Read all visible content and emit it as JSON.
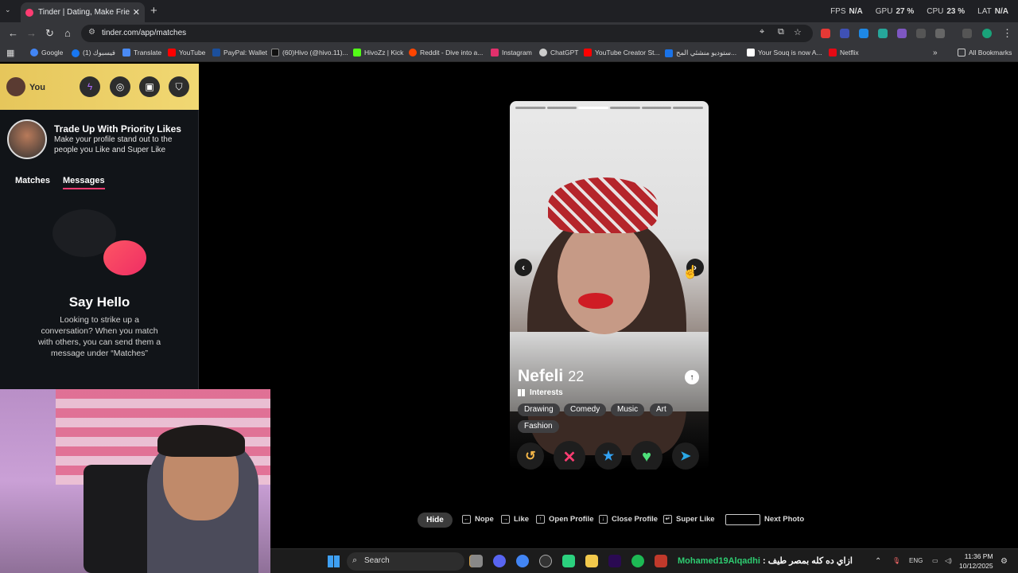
{
  "browser": {
    "tab_title": "Tinder | Dating, Make Friends &",
    "url": "tinder.com/app/matches",
    "perf": [
      {
        "label": "FPS",
        "value": "N/A"
      },
      {
        "label": "GPU",
        "value": "27 %"
      },
      {
        "label": "CPU",
        "value": "23 %"
      },
      {
        "label": "LAT",
        "value": "N/A"
      }
    ],
    "bookmarks": [
      {
        "label": "Google",
        "color": "#4285f4"
      },
      {
        "label": "فيسبوك (1)",
        "color": "#1877f2"
      },
      {
        "label": "Translate",
        "color": "#4a8af4"
      },
      {
        "label": "YouTube",
        "color": "#ff0000"
      },
      {
        "label": "PayPal: Wallet",
        "color": "#1b4f9c"
      },
      {
        "label": "(60)Hivo (@hivo.11)...",
        "color": "#111111"
      },
      {
        "label": "HivoZz | Kick",
        "color": "#53fc18"
      },
      {
        "label": "Reddit - Dive into a...",
        "color": "#ff4500"
      },
      {
        "label": "Instagram",
        "color": "#e1306c"
      },
      {
        "label": "ChatGPT",
        "color": "#cccccc"
      },
      {
        "label": "YouTube Creator St...",
        "color": "#ff0000"
      },
      {
        "label": "ستوديو منشئي المح...",
        "color": "#1a73e8"
      },
      {
        "label": "Your Souq is now A...",
        "color": "#ffffff"
      },
      {
        "label": "Netflix",
        "color": "#e50914"
      }
    ],
    "all_bookmarks": "All Bookmarks"
  },
  "sidebar": {
    "you_label": "You",
    "promo_title": "Trade Up With Priority Likes",
    "promo_sub": "Make your profile stand out to the people you Like and Super Like",
    "tabs": [
      "Matches",
      "Messages"
    ],
    "empty_title": "Say Hello",
    "empty_sub": "Looking to strike up a conversation? When you match with others, you can send them a message under “Matches”"
  },
  "profile": {
    "name": "Nefeli",
    "age": "22",
    "interests_label": "Interests",
    "interests": [
      "Drawing",
      "Comedy",
      "Music",
      "Art",
      "Fashion"
    ],
    "photo_count": 6,
    "active_photo": 3
  },
  "actions": {
    "rewind": "↺",
    "nope": "✕",
    "superlike": "★",
    "like": "♥",
    "boost": "➤"
  },
  "shortcuts": {
    "hide": "Hide",
    "items": [
      "Nope",
      "Like",
      "Open Profile",
      "Close Profile",
      "Super Like",
      "Next Photo"
    ]
  },
  "taskbar": {
    "search": "Search",
    "ticker_user": "Mohamed19Alqadhi",
    "ticker_text": " : ازاي ده كله بمصر طيف",
    "lang": "ENG",
    "time": "11:36 PM",
    "date": "10/12/2025"
  },
  "colors": {
    "brand": "#fe3c72",
    "gold": "#e6c65b"
  }
}
